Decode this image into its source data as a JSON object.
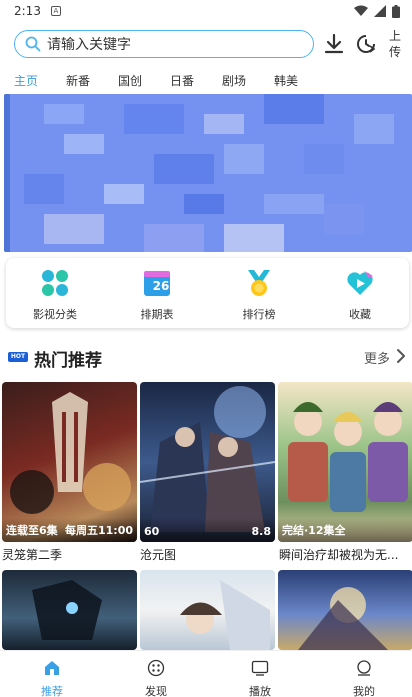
{
  "status_bar": {
    "time": "2:13",
    "notif_glyph": "A"
  },
  "search": {
    "placeholder": "请输入关键字",
    "upload_label": "上传"
  },
  "tabs": [
    {
      "label": "主页",
      "active": true
    },
    {
      "label": "新番"
    },
    {
      "label": "国创"
    },
    {
      "label": "日番"
    },
    {
      "label": "剧场"
    },
    {
      "label": "韩美"
    }
  ],
  "quick_menu": [
    {
      "label": "影视分类",
      "icon": "grid-petals-icon"
    },
    {
      "label": "排期表",
      "icon": "calendar-icon",
      "day": "26"
    },
    {
      "label": "排行榜",
      "icon": "medal-icon"
    },
    {
      "label": "收藏",
      "icon": "heart-play-icon"
    }
  ],
  "hot": {
    "badge": "HOT",
    "title": "热门推荐",
    "more_label": "更多",
    "cards": [
      {
        "title": "灵笼第二季",
        "left_text": "连载至6集",
        "right_text": "每周五11:00"
      },
      {
        "title": "沧元图",
        "left_text": "60",
        "right_text": "8.8"
      },
      {
        "title": "瞬间治疗却被视为无...",
        "left_text": "完结·12集全",
        "right_text": ""
      }
    ]
  },
  "bottom_nav": [
    {
      "label": "推荐",
      "active": true
    },
    {
      "label": "发现"
    },
    {
      "label": "播放"
    },
    {
      "label": "我的"
    }
  ],
  "colors": {
    "accent": "#3aa0e6",
    "search_border": "#4fb4ee",
    "hot_badge": "#1a5fd6"
  }
}
